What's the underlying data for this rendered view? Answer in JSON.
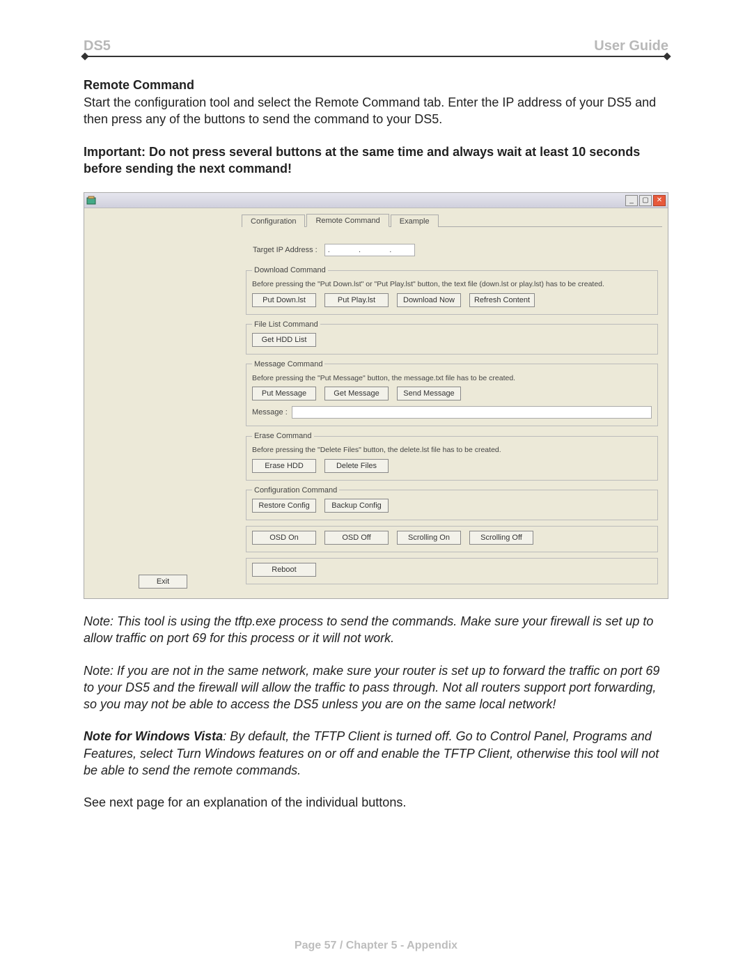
{
  "header": {
    "left": "DS5",
    "right": "User Guide"
  },
  "section": {
    "title": "Remote Command",
    "intro": "Start the configuration tool and select the Remote Command tab. Enter the IP address of your DS5 and then press any of the buttons to send the command to your DS5.",
    "important": "Important: Do not press several buttons at the same time and always wait at least 10 seconds before sending the next command!"
  },
  "window": {
    "tabs": {
      "config": "Configuration",
      "remote": "Remote Command",
      "example": "Example"
    },
    "target_label": "Target IP Address :",
    "target_value": ".   .   .",
    "download": {
      "legend": "Download Command",
      "help": "Before pressing the \"Put Down.lst\" or \"Put Play.lst\" button, the text file (down.lst or play.lst) has to be created.",
      "btn_putdown": "Put Down.lst",
      "btn_putplay": "Put Play.lst",
      "btn_dlnow": "Download Now",
      "btn_refresh": "Refresh Content"
    },
    "filelist": {
      "legend": "File List Command",
      "btn_gethdd": "Get HDD List"
    },
    "message": {
      "legend": "Message Command",
      "help": "Before pressing the \"Put Message\" button, the message.txt file has to be created.",
      "btn_putmsg": "Put Message",
      "btn_getmsg": "Get Message",
      "btn_sendmsg": "Send Message",
      "msg_label": "Message :"
    },
    "erase": {
      "legend": "Erase Command",
      "help": "Before pressing the \"Delete Files\" button, the delete.lst file has to be created.",
      "btn_erasehdd": "Erase HDD",
      "btn_delfiles": "Delete Files"
    },
    "config_cmd": {
      "legend": "Configuration Command",
      "btn_restore": "Restore Config",
      "btn_backup": "Backup Config"
    },
    "misc": {
      "btn_osdon": "OSD On",
      "btn_osdoff": "OSD Off",
      "btn_scrollon": "Scrolling On",
      "btn_scrolloff": "Scrolling Off",
      "btn_reboot": "Reboot"
    },
    "exit": "Exit"
  },
  "notes": {
    "n1": "Note: This tool is using the tftp.exe process to send the commands. Make sure your firewall is set up to allow traffic on port 69 for this process or it will not work.",
    "n2": "Note: If you are not in the same network, make sure your router is set up to forward the traffic on port 69 to your DS5 and the firewall will allow the traffic to pass through. Not all routers support port forwarding, so you may not be able to access the DS5 unless you are on the same local network!",
    "n3_bold": "Note for Windows Vista",
    "n3_rest": ": By default, the TFTP Client is turned off. Go to Control Panel, Programs and Features, select Turn Windows features on or off and enable the TFTP Client, otherwise this tool will not be able to send the remote commands.",
    "next": "See next page for an explanation of the individual buttons."
  },
  "footer": "Page 57  /  Chapter 5 - Appendix"
}
